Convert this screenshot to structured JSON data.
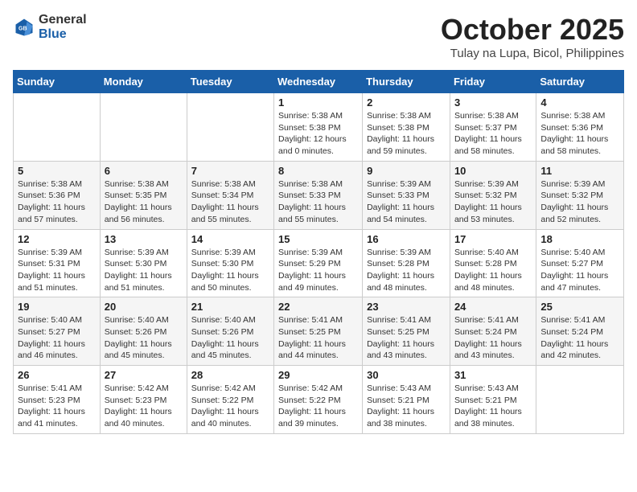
{
  "header": {
    "logo_general": "General",
    "logo_blue": "Blue",
    "month": "October 2025",
    "location": "Tulay na Lupa, Bicol, Philippines"
  },
  "weekdays": [
    "Sunday",
    "Monday",
    "Tuesday",
    "Wednesday",
    "Thursday",
    "Friday",
    "Saturday"
  ],
  "weeks": [
    [
      {
        "day": "",
        "info": ""
      },
      {
        "day": "",
        "info": ""
      },
      {
        "day": "",
        "info": ""
      },
      {
        "day": "1",
        "info": "Sunrise: 5:38 AM\nSunset: 5:38 PM\nDaylight: 12 hours\nand 0 minutes."
      },
      {
        "day": "2",
        "info": "Sunrise: 5:38 AM\nSunset: 5:38 PM\nDaylight: 11 hours\nand 59 minutes."
      },
      {
        "day": "3",
        "info": "Sunrise: 5:38 AM\nSunset: 5:37 PM\nDaylight: 11 hours\nand 58 minutes."
      },
      {
        "day": "4",
        "info": "Sunrise: 5:38 AM\nSunset: 5:36 PM\nDaylight: 11 hours\nand 58 minutes."
      }
    ],
    [
      {
        "day": "5",
        "info": "Sunrise: 5:38 AM\nSunset: 5:36 PM\nDaylight: 11 hours\nand 57 minutes."
      },
      {
        "day": "6",
        "info": "Sunrise: 5:38 AM\nSunset: 5:35 PM\nDaylight: 11 hours\nand 56 minutes."
      },
      {
        "day": "7",
        "info": "Sunrise: 5:38 AM\nSunset: 5:34 PM\nDaylight: 11 hours\nand 55 minutes."
      },
      {
        "day": "8",
        "info": "Sunrise: 5:38 AM\nSunset: 5:33 PM\nDaylight: 11 hours\nand 55 minutes."
      },
      {
        "day": "9",
        "info": "Sunrise: 5:39 AM\nSunset: 5:33 PM\nDaylight: 11 hours\nand 54 minutes."
      },
      {
        "day": "10",
        "info": "Sunrise: 5:39 AM\nSunset: 5:32 PM\nDaylight: 11 hours\nand 53 minutes."
      },
      {
        "day": "11",
        "info": "Sunrise: 5:39 AM\nSunset: 5:32 PM\nDaylight: 11 hours\nand 52 minutes."
      }
    ],
    [
      {
        "day": "12",
        "info": "Sunrise: 5:39 AM\nSunset: 5:31 PM\nDaylight: 11 hours\nand 51 minutes."
      },
      {
        "day": "13",
        "info": "Sunrise: 5:39 AM\nSunset: 5:30 PM\nDaylight: 11 hours\nand 51 minutes."
      },
      {
        "day": "14",
        "info": "Sunrise: 5:39 AM\nSunset: 5:30 PM\nDaylight: 11 hours\nand 50 minutes."
      },
      {
        "day": "15",
        "info": "Sunrise: 5:39 AM\nSunset: 5:29 PM\nDaylight: 11 hours\nand 49 minutes."
      },
      {
        "day": "16",
        "info": "Sunrise: 5:39 AM\nSunset: 5:28 PM\nDaylight: 11 hours\nand 48 minutes."
      },
      {
        "day": "17",
        "info": "Sunrise: 5:40 AM\nSunset: 5:28 PM\nDaylight: 11 hours\nand 48 minutes."
      },
      {
        "day": "18",
        "info": "Sunrise: 5:40 AM\nSunset: 5:27 PM\nDaylight: 11 hours\nand 47 minutes."
      }
    ],
    [
      {
        "day": "19",
        "info": "Sunrise: 5:40 AM\nSunset: 5:27 PM\nDaylight: 11 hours\nand 46 minutes."
      },
      {
        "day": "20",
        "info": "Sunrise: 5:40 AM\nSunset: 5:26 PM\nDaylight: 11 hours\nand 45 minutes."
      },
      {
        "day": "21",
        "info": "Sunrise: 5:40 AM\nSunset: 5:26 PM\nDaylight: 11 hours\nand 45 minutes."
      },
      {
        "day": "22",
        "info": "Sunrise: 5:41 AM\nSunset: 5:25 PM\nDaylight: 11 hours\nand 44 minutes."
      },
      {
        "day": "23",
        "info": "Sunrise: 5:41 AM\nSunset: 5:25 PM\nDaylight: 11 hours\nand 43 minutes."
      },
      {
        "day": "24",
        "info": "Sunrise: 5:41 AM\nSunset: 5:24 PM\nDaylight: 11 hours\nand 43 minutes."
      },
      {
        "day": "25",
        "info": "Sunrise: 5:41 AM\nSunset: 5:24 PM\nDaylight: 11 hours\nand 42 minutes."
      }
    ],
    [
      {
        "day": "26",
        "info": "Sunrise: 5:41 AM\nSunset: 5:23 PM\nDaylight: 11 hours\nand 41 minutes."
      },
      {
        "day": "27",
        "info": "Sunrise: 5:42 AM\nSunset: 5:23 PM\nDaylight: 11 hours\nand 40 minutes."
      },
      {
        "day": "28",
        "info": "Sunrise: 5:42 AM\nSunset: 5:22 PM\nDaylight: 11 hours\nand 40 minutes."
      },
      {
        "day": "29",
        "info": "Sunrise: 5:42 AM\nSunset: 5:22 PM\nDaylight: 11 hours\nand 39 minutes."
      },
      {
        "day": "30",
        "info": "Sunrise: 5:43 AM\nSunset: 5:21 PM\nDaylight: 11 hours\nand 38 minutes."
      },
      {
        "day": "31",
        "info": "Sunrise: 5:43 AM\nSunset: 5:21 PM\nDaylight: 11 hours\nand 38 minutes."
      },
      {
        "day": "",
        "info": ""
      }
    ]
  ]
}
